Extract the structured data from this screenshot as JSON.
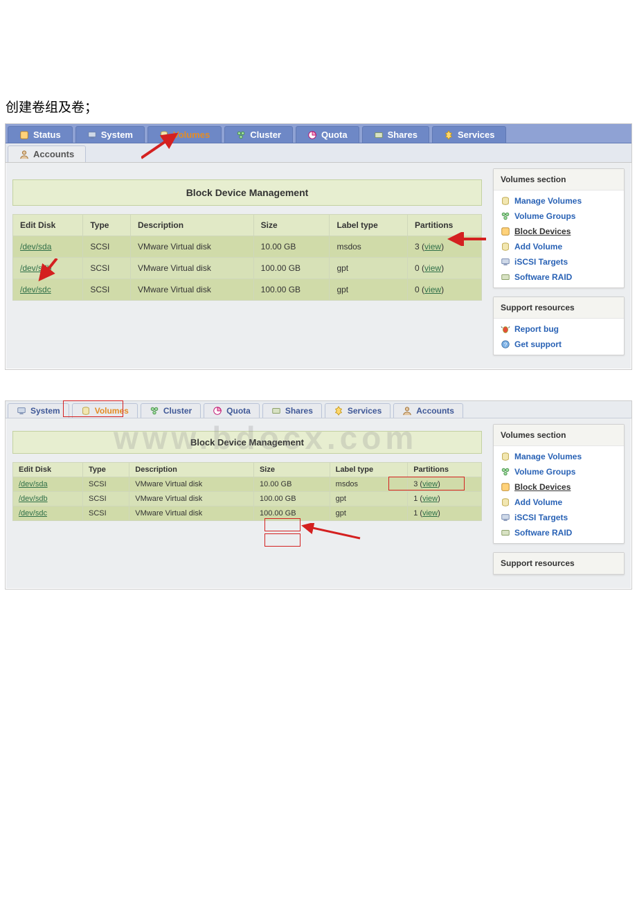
{
  "caption": "创建卷组及卷；",
  "shot1": {
    "tabs_top": [
      {
        "label": "Status",
        "icon": "status-icon"
      },
      {
        "label": "System",
        "icon": "system-icon"
      },
      {
        "label": "Volumes",
        "icon": "volumes-icon",
        "active": true
      },
      {
        "label": "Cluster",
        "icon": "cluster-icon"
      },
      {
        "label": "Quota",
        "icon": "quota-icon"
      },
      {
        "label": "Shares",
        "icon": "shares-icon"
      },
      {
        "label": "Services",
        "icon": "services-icon"
      }
    ],
    "tabs_second": [
      {
        "label": "Accounts",
        "icon": "accounts-icon"
      }
    ],
    "panel_title": "Block Device Management",
    "table": {
      "headers": [
        "Edit Disk",
        "Type",
        "Description",
        "Size",
        "Label type",
        "Partitions"
      ],
      "rows": [
        {
          "disk": "/dev/sda",
          "type": "SCSI",
          "desc": "VMware Virtual disk",
          "size": "10.00 GB",
          "label": "msdos",
          "partitions_count": "3",
          "partitions_link": "view"
        },
        {
          "disk": "/dev/sdb",
          "type": "SCSI",
          "desc": "VMware Virtual disk",
          "size": "100.00 GB",
          "label": "gpt",
          "partitions_count": "0",
          "partitions_link": "view"
        },
        {
          "disk": "/dev/sdc",
          "type": "SCSI",
          "desc": "VMware Virtual disk",
          "size": "100.00 GB",
          "label": "gpt",
          "partitions_count": "0",
          "partitions_link": "view"
        }
      ]
    },
    "side_sections": {
      "volumes": {
        "title": "Volumes section",
        "items": [
          {
            "label": "Manage Volumes",
            "icon": "manage-icon"
          },
          {
            "label": "Volume Groups",
            "icon": "group-icon"
          },
          {
            "label": "Block Devices",
            "icon": "block-icon",
            "current": true
          },
          {
            "label": "Add Volume",
            "icon": "add-icon"
          },
          {
            "label": "iSCSI Targets",
            "icon": "iscsi-icon"
          },
          {
            "label": "Software RAID",
            "icon": "raid-icon"
          }
        ]
      },
      "support": {
        "title": "Support resources",
        "items": [
          {
            "label": "Report bug",
            "icon": "bug-icon"
          },
          {
            "label": "Get support",
            "icon": "support-icon"
          }
        ]
      }
    }
  },
  "shot2": {
    "tabs": [
      {
        "label": "System",
        "icon": "system-icon"
      },
      {
        "label": "Volumes",
        "icon": "volumes-icon",
        "active": true
      },
      {
        "label": "Cluster",
        "icon": "cluster-icon"
      },
      {
        "label": "Quota",
        "icon": "quota-icon"
      },
      {
        "label": "Shares",
        "icon": "shares-icon"
      },
      {
        "label": "Services",
        "icon": "services-icon"
      },
      {
        "label": "Accounts",
        "icon": "accounts-icon"
      }
    ],
    "panel_title": "Block Device Management",
    "table": {
      "headers": [
        "Edit Disk",
        "Type",
        "Description",
        "Size",
        "Label type",
        "Partitions"
      ],
      "rows": [
        {
          "disk": "/dev/sda",
          "type": "SCSI",
          "desc": "VMware Virtual disk",
          "size": "10.00 GB",
          "label": "msdos",
          "partitions_count": "3",
          "partitions_link": "view"
        },
        {
          "disk": "/dev/sdb",
          "type": "SCSI",
          "desc": "VMware Virtual disk",
          "size": "100.00 GB",
          "label": "gpt",
          "partitions_count": "1",
          "partitions_link": "view"
        },
        {
          "disk": "/dev/sdc",
          "type": "SCSI",
          "desc": "VMware Virtual disk",
          "size": "100.00 GB",
          "label": "gpt",
          "partitions_count": "1",
          "partitions_link": "view"
        }
      ]
    },
    "side_sections": {
      "volumes": {
        "title": "Volumes section",
        "items": [
          {
            "label": "Manage Volumes",
            "icon": "manage-icon"
          },
          {
            "label": "Volume Groups",
            "icon": "group-icon"
          },
          {
            "label": "Block Devices",
            "icon": "block-icon",
            "current": true
          },
          {
            "label": "Add Volume",
            "icon": "add-icon"
          },
          {
            "label": "iSCSI Targets",
            "icon": "iscsi-icon"
          },
          {
            "label": "Software RAID",
            "icon": "raid-icon"
          }
        ]
      },
      "support": {
        "title": "Support resources"
      }
    }
  },
  "watermark": "www.bdocx.com"
}
